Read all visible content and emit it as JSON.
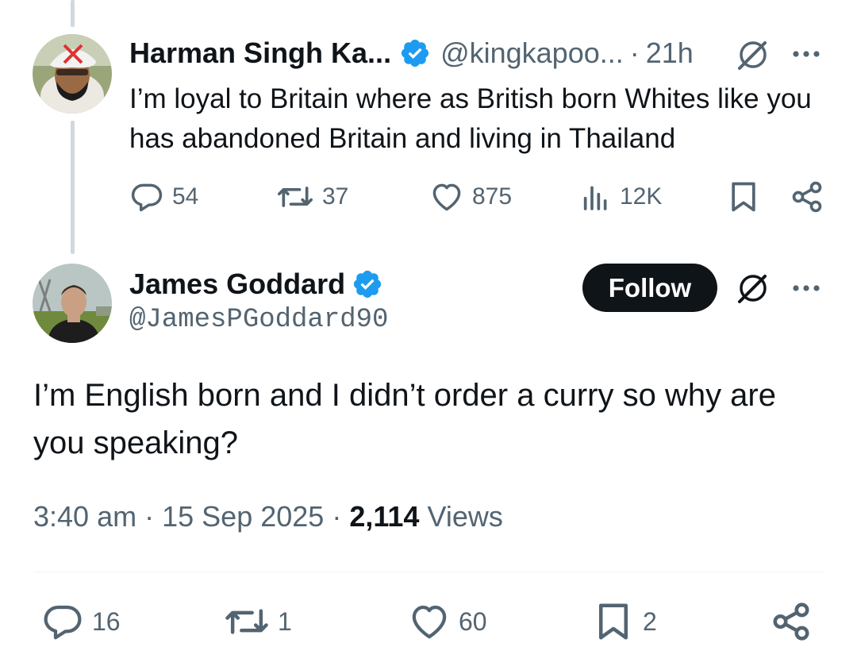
{
  "parent_tweet": {
    "author_name": "Harman Singh Ka...",
    "handle": "@kingkapoo...",
    "separator": "·",
    "time": "21h",
    "text": "I’m loyal to Britain where as British born Whites like you has abandoned Britain and living in Thailand",
    "stats": {
      "replies": "54",
      "reposts": "37",
      "likes": "875",
      "views": "12K"
    }
  },
  "main_tweet": {
    "author_name": "James Goddard",
    "handle": "@JamesPGoddard90",
    "follow_label": "Follow",
    "text": "I’m English born and I didn’t order a curry so why are you speaking?",
    "time": "3:40 am",
    "date": "15 Sep 2025",
    "separator": "·",
    "views_count": "2,114",
    "views_label": "Views",
    "stats": {
      "replies": "16",
      "reposts": "1",
      "likes": "60",
      "bookmarks": "2"
    }
  },
  "icons": {
    "reply": "reply-icon",
    "repost": "repost-icon",
    "like": "heart-icon",
    "views": "views-icon",
    "bookmark": "bookmark-icon",
    "share": "share-icon",
    "verified": "verified-badge-icon",
    "grok": "grok-icon",
    "more": "more-icon"
  },
  "colors": {
    "text_primary": "#0f1419",
    "text_secondary": "#536471",
    "verified_blue": "#1d9bf0",
    "thread_line": "#cfd9de",
    "divider": "#eff3f4",
    "follow_bg": "#0f1419"
  }
}
